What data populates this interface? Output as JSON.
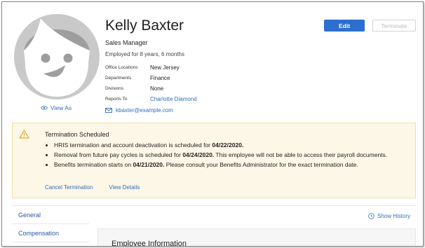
{
  "profile": {
    "name": "Kelly Baxter",
    "job_title": "Sales Manager",
    "tenure": "Employed for 8 years, 6 months",
    "view_as": "View As",
    "email": "kbaxter@example.com",
    "info": [
      {
        "label": "Office Locations",
        "value": "New Jersey"
      },
      {
        "label": "Departments",
        "value": "Finance"
      },
      {
        "label": "Divisions",
        "value": "None"
      },
      {
        "label": "Reports To",
        "value": "Charlotte Diamond"
      }
    ]
  },
  "actions": {
    "edit": "Edit",
    "terminate": "Terminate"
  },
  "alert": {
    "heading": "Termination Scheduled",
    "items": [
      {
        "pre": "HRIS termination and account deactivation is scheduled for ",
        "bold": "04/22/2020.",
        "post": ""
      },
      {
        "pre": "Removal from future pay cycles is scheduled for ",
        "bold": "04/24/2020.",
        "post": " This employee will not be able to access their payroll documents."
      },
      {
        "pre": "Benefits termination starts on ",
        "bold": "04/21/2020.",
        "post": " Please consult your Benefits Administrator for the exact termination date."
      }
    ],
    "cancel": "Cancel Termination",
    "details": "View Details"
  },
  "nav": {
    "items": [
      "General",
      "Compensation"
    ]
  },
  "show_history": "Show History",
  "section_title": "Employee Information",
  "colors": {
    "primary": "#2d6fd0",
    "link": "#2f6fb6",
    "alert_bg": "#fdf7e7",
    "alert_border": "#f3dfa3"
  }
}
